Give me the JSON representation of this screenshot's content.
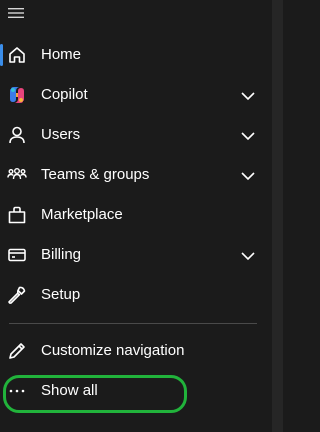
{
  "nav": {
    "menu_icon": "hamburger-icon",
    "items": [
      {
        "label": "Home",
        "icon": "home-icon",
        "expandable": false,
        "active": true
      },
      {
        "label": "Copilot",
        "icon": "copilot-icon",
        "expandable": true
      },
      {
        "label": "Users",
        "icon": "user-icon",
        "expandable": true
      },
      {
        "label": "Teams & groups",
        "icon": "people-group-icon",
        "expandable": true
      },
      {
        "label": "Marketplace",
        "icon": "shopping-bag-icon",
        "expandable": false
      },
      {
        "label": "Billing",
        "icon": "credit-card-icon",
        "expandable": true
      },
      {
        "label": "Setup",
        "icon": "wrench-icon",
        "expandable": false
      }
    ],
    "footer": [
      {
        "label": "Customize navigation",
        "icon": "pencil-icon"
      },
      {
        "label": "Show all",
        "icon": "more-dots-icon"
      }
    ]
  },
  "colors": {
    "background": "#1b1b1b",
    "text": "#ffffff",
    "active_indicator": "#3b8eea",
    "highlight_circle": "#21b33b"
  }
}
